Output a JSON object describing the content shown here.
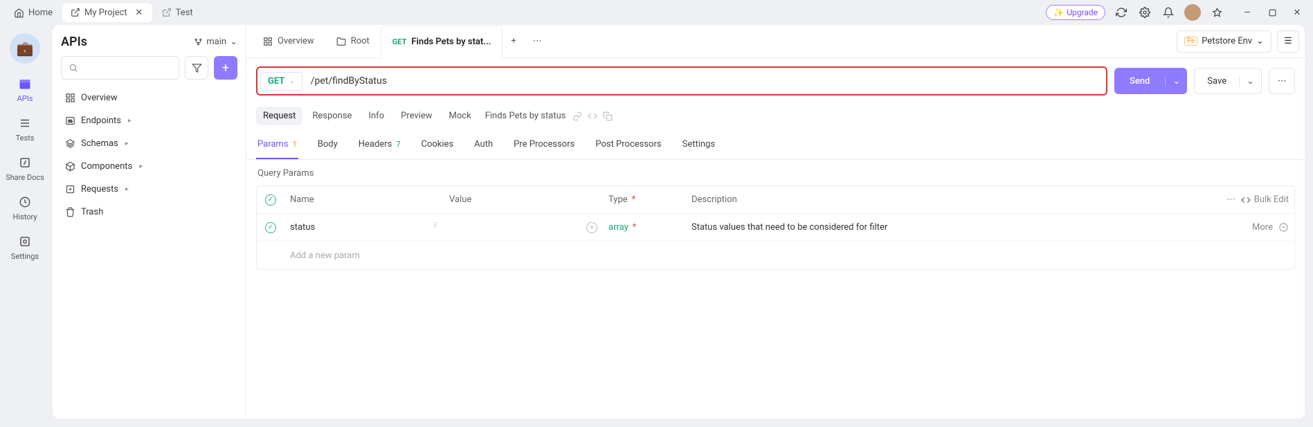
{
  "topbar": {
    "home": "Home",
    "project_tab": "My Project",
    "test_tab": "Test",
    "upgrade": "Upgrade"
  },
  "rail": {
    "apis": "APIs",
    "tests": "Tests",
    "share": "Share Docs",
    "history": "History",
    "settings": "Settings"
  },
  "sidebar": {
    "title": "APIs",
    "branch": "main",
    "overview": "Overview",
    "endpoints": "Endpoints",
    "schemas": "Schemas",
    "components": "Components",
    "requests": "Requests",
    "trash": "Trash"
  },
  "content_tabs": {
    "overview": "Overview",
    "root": "Root",
    "active_method": "GET",
    "active_label": "Finds Pets by stat..."
  },
  "env": {
    "badge": "Pe",
    "name": "Petstore Env"
  },
  "url": {
    "method": "GET",
    "path": "/pet/findByStatus"
  },
  "buttons": {
    "send": "Send",
    "save": "Save"
  },
  "subtabs": {
    "request": "Request",
    "response": "Response",
    "info": "Info",
    "preview": "Preview",
    "mock": "Mock",
    "api_name": "Finds Pets by status"
  },
  "sectabs": {
    "params": "Params",
    "params_count": "1",
    "body": "Body",
    "headers": "Headers",
    "headers_count": "7",
    "cookies": "Cookies",
    "auth": "Auth",
    "pre": "Pre Processors",
    "post": "Post Processors",
    "settings": "Settings"
  },
  "params": {
    "section_title": "Query Params",
    "header_name": "Name",
    "header_value": "Value",
    "header_type": "Type",
    "header_desc": "Description",
    "bulk_edit": "Bulk Edit",
    "row1_name": "status",
    "row1_type": "array",
    "row1_desc": "Status values that need to be considered for filter",
    "row1_more": "More",
    "add_placeholder": "Add a new param"
  }
}
